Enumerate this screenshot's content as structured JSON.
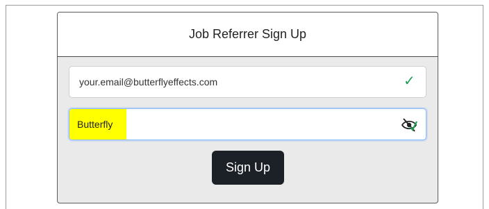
{
  "form": {
    "title": "Job Referrer Sign Up",
    "email": {
      "value": "your.email@butterflyeffects.com",
      "valid_icon": "check-icon"
    },
    "password": {
      "value": "Butterfly",
      "toggle_icon": "eye-slash-icon",
      "valid_icon": "check-icon"
    },
    "submit_label": "Sign Up"
  },
  "colors": {
    "valid": "#1e9e55",
    "button": "#1c2127",
    "highlight": "#ffff00"
  }
}
